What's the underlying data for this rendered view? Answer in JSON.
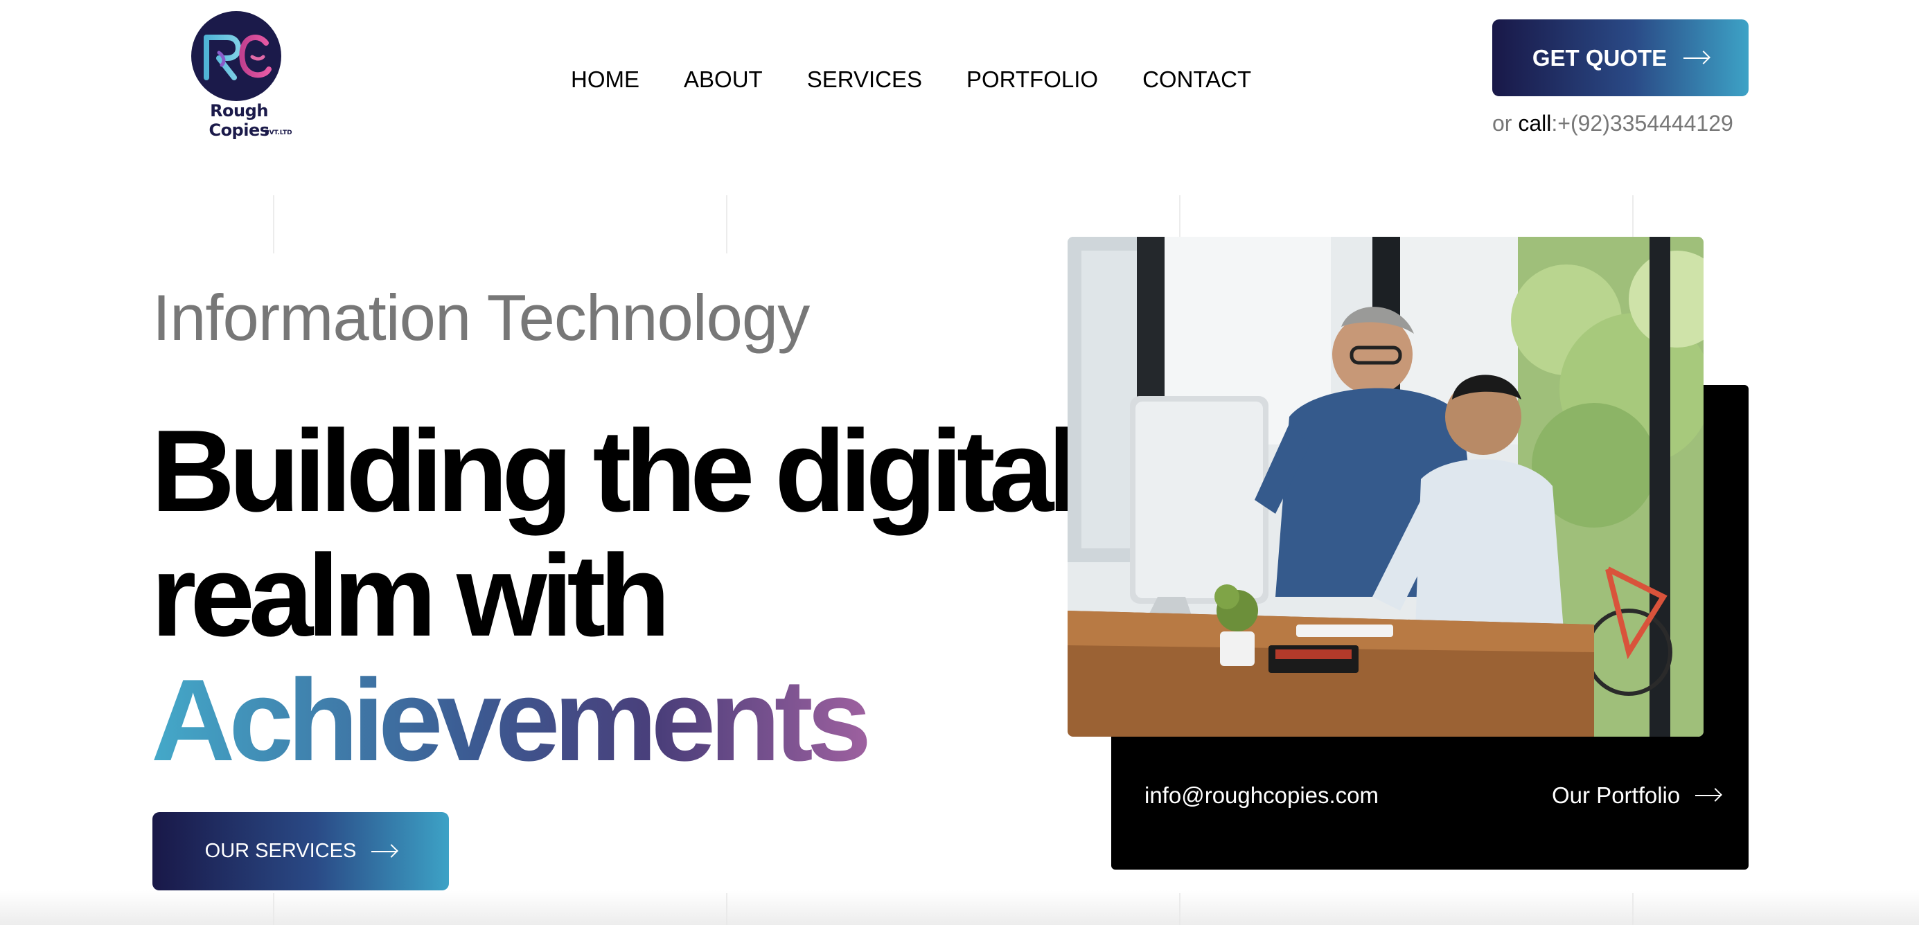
{
  "brand": {
    "logo_monogram": "RC",
    "name": "Rough Copies",
    "suffix": "PVT.LTD",
    "colors": {
      "navy": "#1b1a4a",
      "teal": "#3da2c6",
      "pink": "#e489c0"
    }
  },
  "nav": {
    "items": [
      {
        "label": "HOME"
      },
      {
        "label": "ABOUT"
      },
      {
        "label": "SERVICES"
      },
      {
        "label": "PORTFOLIO"
      },
      {
        "label": "CONTACT"
      }
    ]
  },
  "header": {
    "quote_label": "GET QUOTE",
    "quote_icon": "arrow-right-icon",
    "call_prefix": "or ",
    "call_word": "call",
    "call_number": ":+(92)3354444129"
  },
  "hero": {
    "eyebrow": "Information Technology",
    "headline_line1": "Building the digital",
    "headline_line2": "realm with",
    "headline_highlight": "Achievements",
    "services_label": "OUR SERVICES",
    "services_icon": "arrow-right-icon",
    "image_icon": "office-photo",
    "email": "info@roughcopies.com",
    "portfolio_label": "Our Portfolio",
    "portfolio_icon": "arrow-right-icon"
  }
}
